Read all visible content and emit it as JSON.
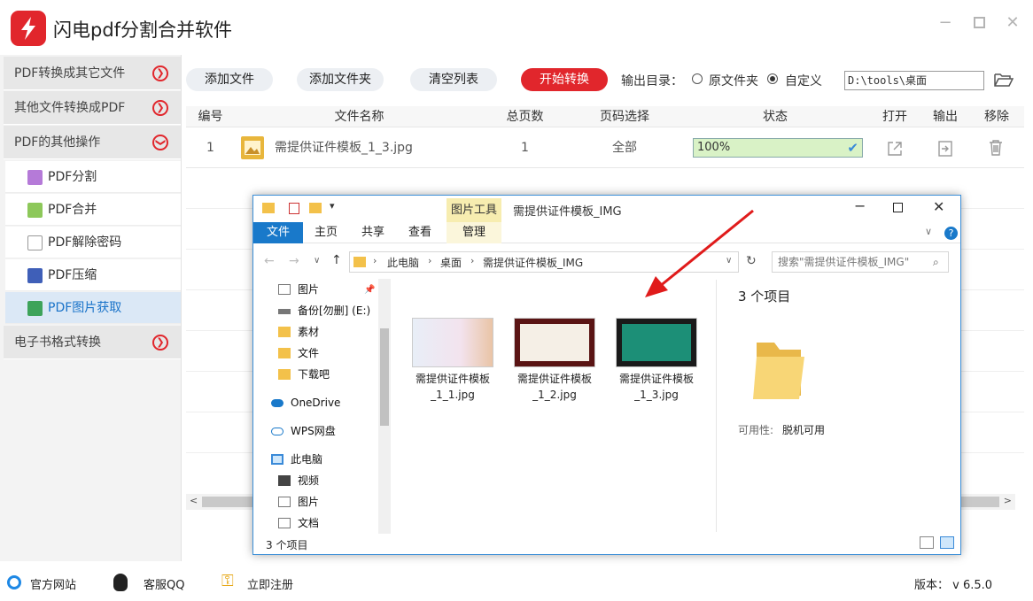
{
  "app": {
    "title": "闪电pdf分割合并软件"
  },
  "sidebar": {
    "sections": [
      {
        "label": "PDF转换成其它文件"
      },
      {
        "label": "其他文件转换成PDF"
      },
      {
        "label": "PDF的其他操作"
      },
      {
        "label": "电子书格式转换"
      }
    ],
    "items": [
      {
        "label": "PDF分割"
      },
      {
        "label": "PDF合并"
      },
      {
        "label": "PDF解除密码"
      },
      {
        "label": "PDF压缩"
      },
      {
        "label": "PDF图片获取"
      }
    ]
  },
  "toolbar": {
    "add_file": "添加文件",
    "add_folder": "添加文件夹",
    "clear_list": "清空列表",
    "start": "开始转换",
    "output_label": "输出目录：",
    "opt_original": "原文件夹",
    "opt_custom": "自定义",
    "output_path": "D:\\tools\\桌面"
  },
  "table": {
    "headers": [
      "编号",
      "文件名称",
      "总页数",
      "页码选择",
      "状态",
      "打开",
      "输出",
      "移除"
    ],
    "rows": [
      {
        "index": "1",
        "name": "需提供证件模板_1_3.jpg",
        "pages": "1",
        "range": "全部",
        "status": "100%",
        "progress": 1.0
      }
    ]
  },
  "footer": {
    "website": "官方网站",
    "qq": "客服QQ",
    "register": "立即注册",
    "version": "版本： v 6.5.0"
  },
  "explorer": {
    "title": "需提供证件模板_IMG",
    "context_tab": "图片工具",
    "tabs": [
      "文件",
      "主页",
      "共享",
      "查看",
      "管理"
    ],
    "breadcrumb": [
      "此电脑",
      "桌面",
      "需提供证件模板_IMG"
    ],
    "search_placeholder": "搜索\"需提供证件模板_IMG\"",
    "nav": [
      {
        "label": "图片",
        "icon": "pictures-icon"
      },
      {
        "label": "备份[勿删] (E:)",
        "icon": "drive-icon"
      },
      {
        "label": "素材",
        "icon": "folder-icon"
      },
      {
        "label": "文件",
        "icon": "folder-icon"
      },
      {
        "label": "下载吧",
        "icon": "folder-icon"
      },
      {
        "label": "OneDrive",
        "icon": "cloud-icon"
      },
      {
        "label": "WPS网盘",
        "icon": "cloud-icon"
      },
      {
        "label": "此电脑",
        "icon": "computer-icon"
      },
      {
        "label": "视频",
        "icon": "video-icon"
      },
      {
        "label": "图片",
        "icon": "pictures-icon"
      },
      {
        "label": "文档",
        "icon": "document-icon"
      }
    ],
    "files": [
      {
        "line1": "需提供证件模板",
        "line2": "_1_1.jpg"
      },
      {
        "line1": "需提供证件模板",
        "line2": "_1_2.jpg"
      },
      {
        "line1": "需提供证件模板",
        "line2": "_1_3.jpg"
      }
    ],
    "details": {
      "count": "3 个项目",
      "avail_label": "可用性:",
      "avail_value": "脱机可用"
    },
    "status": "3 个项目"
  },
  "colors": {
    "accent": "#e1262c",
    "blue": "#1a73c9",
    "progress": "#d9f2c6"
  }
}
